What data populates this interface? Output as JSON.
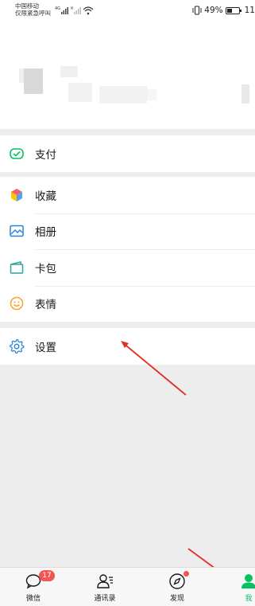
{
  "status_bar": {
    "carrier_line1": "中国移动",
    "carrier_line2": "仅限紧急呼叫",
    "net_label": "4G",
    "battery_percent": "49%",
    "time_partial": "11",
    "battery_level": 0.49
  },
  "menu": {
    "pay": "支付",
    "favorites": "收藏",
    "album": "相册",
    "cards": "卡包",
    "stickers": "表情",
    "settings": "设置"
  },
  "tabs": {
    "chats": "微信",
    "chats_badge": "17",
    "contacts": "通讯录",
    "discover": "发现",
    "me": "我"
  },
  "colors": {
    "accent": "#07c160",
    "badge": "#f45454",
    "annotation_arrow": "#e0302a"
  }
}
